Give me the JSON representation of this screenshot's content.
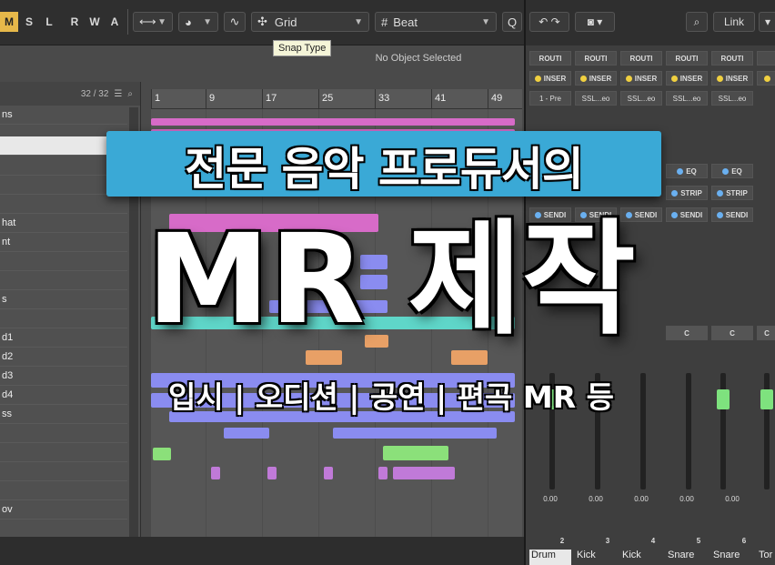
{
  "toolbar": {
    "mode_buttons": [
      "M",
      "S",
      "L",
      "R",
      "W",
      "A"
    ],
    "grid_select": "Grid",
    "quantize_select": "Beat",
    "snap_tooltip": "Snap Type",
    "info_text": "No Object Selected"
  },
  "tracklist": {
    "count": "32 / 32",
    "partial_labels": [
      "ns",
      "hat",
      "nt",
      "s",
      "d1",
      "d2",
      "d3",
      "d4",
      "ss",
      "ov"
    ]
  },
  "ruler": {
    "bars": [
      "1",
      "9",
      "17",
      "25",
      "33",
      "41",
      "49"
    ]
  },
  "mixer": {
    "link_label": "Link",
    "routing_label": "ROUTI",
    "insert_label": "INSER",
    "insert_slot": "1 - Pre",
    "plugin_label": "SSL...eo",
    "eq_label": "EQ",
    "strip_label": "STRIP",
    "send_label": "SENDI",
    "pan_label": "C",
    "volume_value": "0.00",
    "channel_numbers": [
      "2",
      "3",
      "4",
      "5",
      "6"
    ],
    "channel_names": [
      "Drum",
      "Kick",
      "Kick",
      "Snare",
      "Snare",
      "Tor"
    ]
  },
  "overlay": {
    "headline": "전문 음악 프로듀서의",
    "title": "MR 제작",
    "subtitle": "입시 | 오디션 | 공연 | 편곡 MR 등"
  },
  "colors": {
    "accent_blue": "#3aa9d6",
    "clip_pink": "#d76bc8",
    "clip_blue": "#8a8cf0",
    "clip_teal": "#5fd6c9",
    "clip_orange": "#e8a066",
    "clip_green": "#8be07a",
    "clip_purple": "#c07ad8",
    "fader_green": "#7ee27e"
  }
}
